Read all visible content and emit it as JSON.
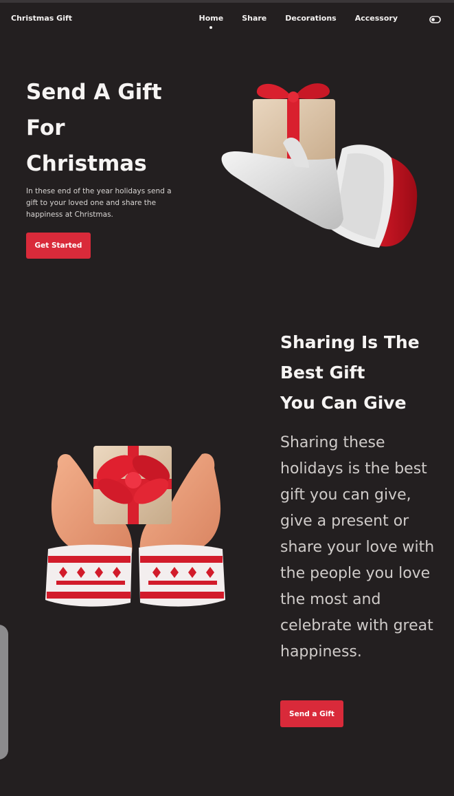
{
  "nav": {
    "brand": "Christmas Gift",
    "links": [
      "Home",
      "Share",
      "Decorations",
      "Accessory"
    ],
    "active_link": "Home"
  },
  "hero": {
    "title": "Send A Gift\nFor\nChristmas",
    "description": "In these end of the year holidays send a gift to your loved one and share the happiness at Christmas.",
    "button_label": "Get Started"
  },
  "share": {
    "title": "Sharing Is The\nBest Gift\nYou Can Give",
    "description": "Sharing these holidays is the best gift you can give, give a present or share your love with the people you love the most and celebrate with great happiness.",
    "button_label": "Send a Gift"
  },
  "icons": {
    "theme_toggle": "toggle-icon"
  },
  "colors": {
    "background": "#231f20",
    "accent": "#d92a3a",
    "text": "#f6f4f3"
  }
}
